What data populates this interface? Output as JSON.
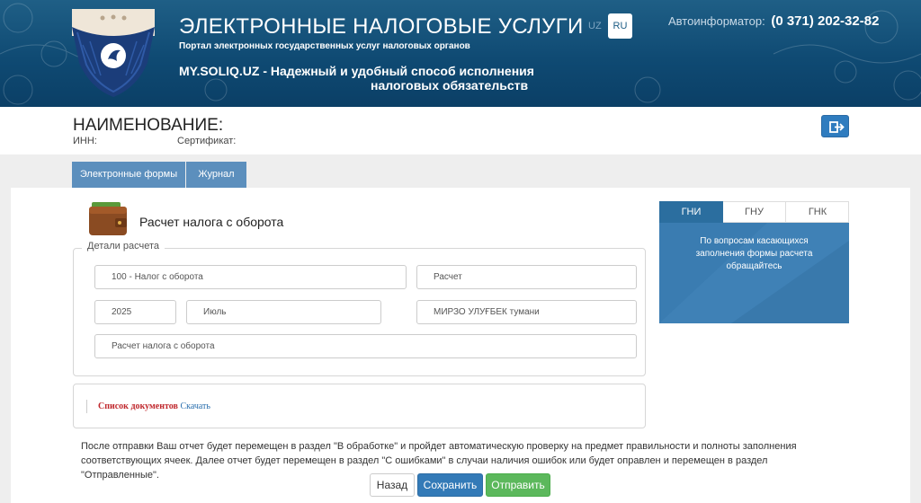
{
  "header": {
    "title": "ЭЛЕКТРОННЫЕ НАЛОГОВЫЕ УСЛУГИ",
    "subtitle": "Портал электронных государственных услуг налоговых органов",
    "slogan_line1": "MY.SOLIQ.UZ - Надежный и удобный способ исполнения",
    "slogan_line2": "налоговых обязательств",
    "lang_uz": "UZ",
    "lang_ru": "RU",
    "autoinformer_label": "Автоинформатор:",
    "autoinformer_phone": "(0 371) 202-32-82"
  },
  "user": {
    "name_label": "НАИМЕНОВАНИЕ:",
    "inn_label": "ИНН:",
    "certificate_label": "Сертификат:"
  },
  "tabs": [
    {
      "label": "Электронные формы",
      "active": true
    },
    {
      "label": "Журнал",
      "active": false
    }
  ],
  "form": {
    "title": "Расчет налога с оборота",
    "legend": "Детали расчета",
    "fields": {
      "tax_type": "100 - Налог с оборота",
      "doc_type": "Расчет",
      "year": "2025",
      "month": "Июль",
      "district": "МИРЗО УЛУҒБЕК тумани",
      "form_name": "Расчет налога с оборота"
    },
    "docs_label": "Список документов",
    "docs_link": "Скачать"
  },
  "note": "После отправки Ваш отчет будет перемещен в раздел \"В обработке\" и пройдет автоматическую проверку на предмет правильности и полноты заполнения соответствующих ячеек. Далее отчет будет перемещен в раздел \"С ошибками\" в случаи наличия ошибок или будет оправлен и перемещен в раздел \"Отправленные\".",
  "buttons": {
    "back": "Назад",
    "save": "Сохранить",
    "send": "Отправить"
  },
  "side": {
    "tabs": [
      "ГНИ",
      "ГНУ",
      "ГНК"
    ],
    "active_tab": "ГНИ",
    "text": "По вопросам касающихся заполнения формы расчета обращайтесь"
  },
  "colors": {
    "header_bg": "#0f4a73",
    "tab_bg": "#5c8fbd",
    "primary": "#337ab7",
    "success": "#5cb85c",
    "side_bg": "#3a7cb1"
  },
  "icons": {
    "logout": "logout-icon",
    "wallet": "wallet-icon",
    "logo": "emblem-logo"
  }
}
